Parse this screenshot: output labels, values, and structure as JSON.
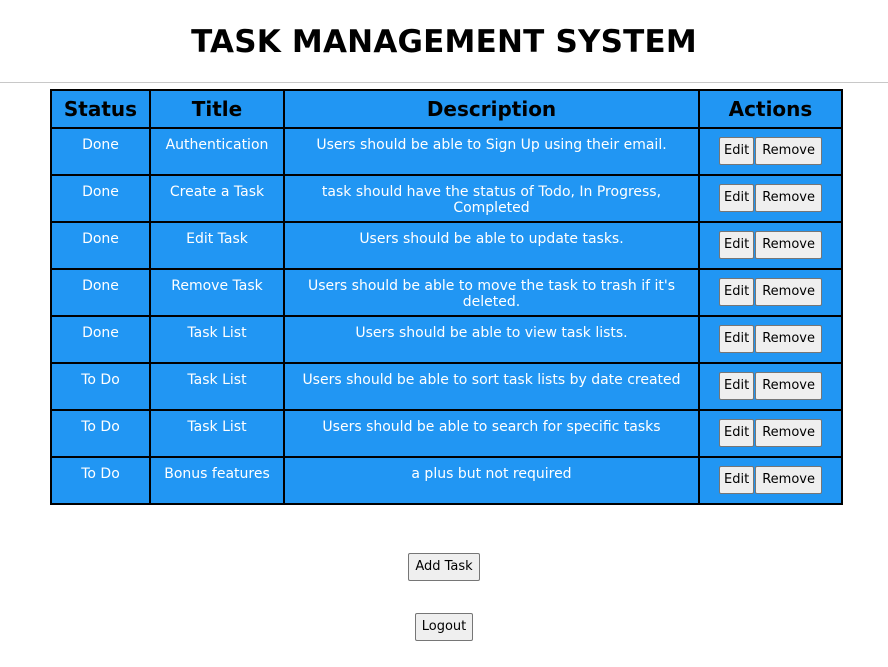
{
  "header": {
    "title": "TASK MANAGEMENT SYSTEM"
  },
  "table": {
    "columns": [
      "Status",
      "Title",
      "Description",
      "Actions"
    ],
    "rows": [
      {
        "status": "Done",
        "title": "Authentication",
        "description": "Users should be able to Sign Up using their email."
      },
      {
        "status": "Done",
        "title": "Create a Task",
        "description": "task should have the status of Todo, In Progress, Completed"
      },
      {
        "status": "Done",
        "title": "Edit Task",
        "description": "Users should be able to update tasks."
      },
      {
        "status": "Done",
        "title": "Remove Task",
        "description": "Users should be able to move the task to trash if it's deleted."
      },
      {
        "status": "Done",
        "title": "Task List",
        "description": "Users should be able to view task lists."
      },
      {
        "status": "To Do",
        "title": "Task List",
        "description": "Users should be able to sort task lists by date created"
      },
      {
        "status": "To Do",
        "title": "Task List",
        "description": "Users should be able to search for specific tasks"
      },
      {
        "status": "To Do",
        "title": "Bonus features",
        "description": "a plus but not required"
      }
    ],
    "edit_label": "Edit",
    "remove_label": "Remove",
    "background_color": "#2196f3"
  },
  "buttons": {
    "add_task": "Add Task",
    "logout": "Logout"
  }
}
